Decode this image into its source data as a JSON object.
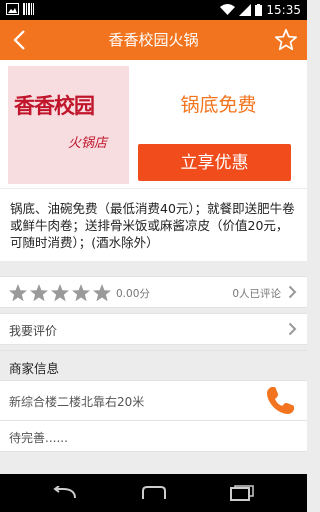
{
  "status_bar": {
    "time": "15:35",
    "icons": [
      "image-icon",
      "barcode-icon",
      "wifi-icon",
      "signal-icon",
      "battery-icon"
    ]
  },
  "action_bar": {
    "title": "香香校园火锅",
    "back_icon": "back-chevron-icon",
    "favorite_icon": "star-outline-icon"
  },
  "store": {
    "logo_text": "香香校园",
    "logo_subtext": "火锅店",
    "promo_title": "锅底免费",
    "claim_button": "立享优惠"
  },
  "description": "锅底、油碗免费（最低消费40元）；就餐即送肥牛卷或鲜牛肉卷；送排骨米饭或麻酱凉皮（价值20元，可随时消费）；(酒水除外）",
  "rating": {
    "stars_total": 5,
    "stars_filled": 0,
    "score": "0.00分",
    "review_count": "0人已评论"
  },
  "my_review": {
    "label": "我要评价"
  },
  "merchant": {
    "section_title": "商家信息",
    "address": "新综合楼二楼北靠右20米",
    "extra": "待完善......"
  },
  "colors": {
    "accent": "#f3741e",
    "button": "#f04c1c",
    "phone": "#f3741e"
  }
}
